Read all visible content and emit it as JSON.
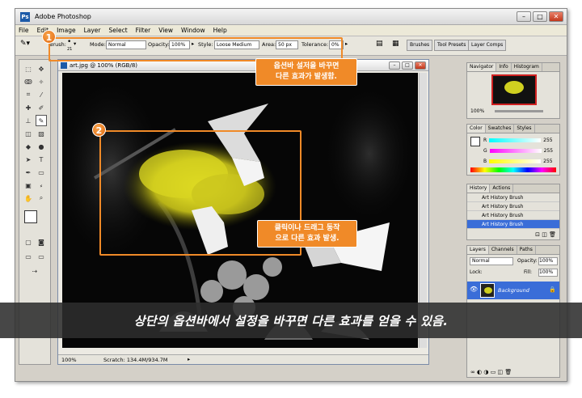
{
  "window": {
    "title": "Adobe Photoshop"
  },
  "menu": [
    "File",
    "Edit",
    "Image",
    "Layer",
    "Select",
    "Filter",
    "View",
    "Window",
    "Help"
  ],
  "options_bar": {
    "brush_label": "Brush:",
    "brush_size": "21",
    "mode_label": "Mode:",
    "mode_value": "Normal",
    "opacity_label": "Opacity:",
    "opacity_value": "100%",
    "style_label": "Style:",
    "style_value": "Loose Medium",
    "area_label": "Area:",
    "area_value": "50 px",
    "tolerance_label": "Tolerance:",
    "tolerance_value": "0%"
  },
  "palette_well": [
    "Brushes",
    "Tool Presets",
    "Layer Comps"
  ],
  "document": {
    "title": "art.jpg @ 100% (RGB/8)",
    "zoom": "100%",
    "scratch": "Scratch: 134.4M/934.7M"
  },
  "callouts": {
    "one_badge": "1",
    "one_text_line1": "옵션바 설저을 바꾸면",
    "one_text_line2": "다른 효과가 발생함.",
    "two_badge": "2",
    "two_text_line1": "클릭이나 드래그 동작",
    "two_text_line2": "으로 다른 효과 발생."
  },
  "navigator": {
    "tabs": [
      "Navigator",
      "Info",
      "Histogram"
    ],
    "zoom": "100%"
  },
  "color_panel": {
    "tabs": [
      "Color",
      "Swatches",
      "Styles"
    ],
    "r": "255",
    "g": "255",
    "b": "255",
    "r_label": "R",
    "g_label": "G",
    "b_label": "B"
  },
  "history": {
    "tabs": [
      "History",
      "Actions"
    ],
    "items": [
      "Art History Brush",
      "Art History Brush",
      "Art History Brush",
      "Art History Brush"
    ]
  },
  "layers": {
    "tabs": [
      "Layers",
      "Channels",
      "Paths"
    ],
    "blend": "Normal",
    "opacity_label": "Opacity:",
    "opacity": "100%",
    "lock_label": "Lock:",
    "fill_label": "Fill:",
    "fill": "100%",
    "layer_name": "Background"
  },
  "banner": "상단의 옵션바에서  설정을 바꾸면 다른 효과를 얻을 수 있음."
}
